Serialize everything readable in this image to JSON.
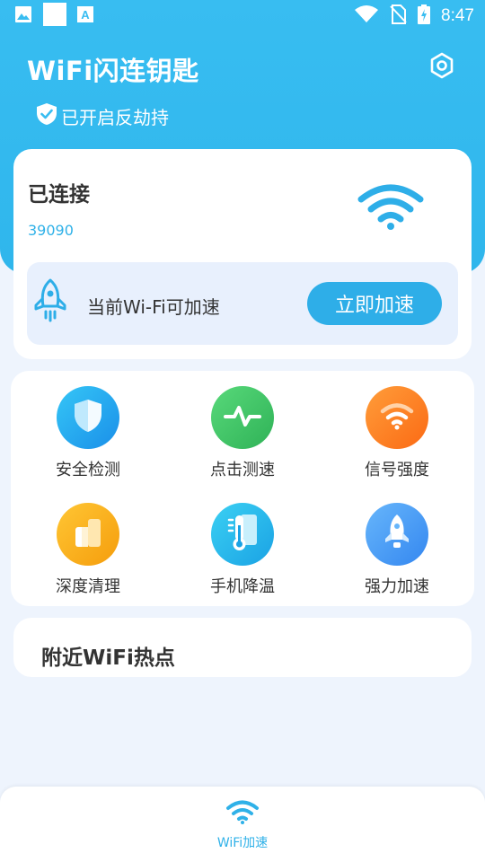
{
  "status_bar": {
    "time": "8:47",
    "left_icons": [
      "image-icon",
      "white-square-icon",
      "text-a-icon"
    ],
    "right_icons": [
      "wifi-icon",
      "no-sim-icon",
      "battery-icon"
    ]
  },
  "header": {
    "title": "WiFi闪连钥匙",
    "protection_status": "已开启反劫持",
    "settings_icon": "settings-icon"
  },
  "connection": {
    "status": "已连接",
    "ssid": "39090",
    "boost_prompt": "当前Wi-Fi可加速",
    "boost_button": "立即加速"
  },
  "tools": [
    {
      "label": "安全检测",
      "icon": "shield-icon",
      "color_from": "#35c6f6",
      "color_to": "#1a8fe9"
    },
    {
      "label": "点击测速",
      "icon": "pulse-icon",
      "color_from": "#58d97a",
      "color_to": "#2fb257"
    },
    {
      "label": "信号强度",
      "icon": "signal-icon",
      "color_from": "#ff9d3a",
      "color_to": "#fb6a14"
    },
    {
      "label": "深度清理",
      "icon": "clean-icon",
      "color_from": "#ffc634",
      "color_to": "#f59d0c"
    },
    {
      "label": "手机降温",
      "icon": "thermometer-icon",
      "color_from": "#3bd0f3",
      "color_to": "#1aa2e4"
    },
    {
      "label": "强力加速",
      "icon": "rocket-icon",
      "color_from": "#67b6fb",
      "color_to": "#3487f0"
    }
  ],
  "nearby": {
    "title": "附近WiFi热点"
  },
  "bottom_nav": {
    "items": [
      {
        "label": "WiFi加速",
        "icon": "wifi-icon",
        "active": true
      }
    ]
  },
  "colors": {
    "primary": "#2fb6ec",
    "accent_text": "#2fb1e8",
    "background": "#eef4fd"
  }
}
